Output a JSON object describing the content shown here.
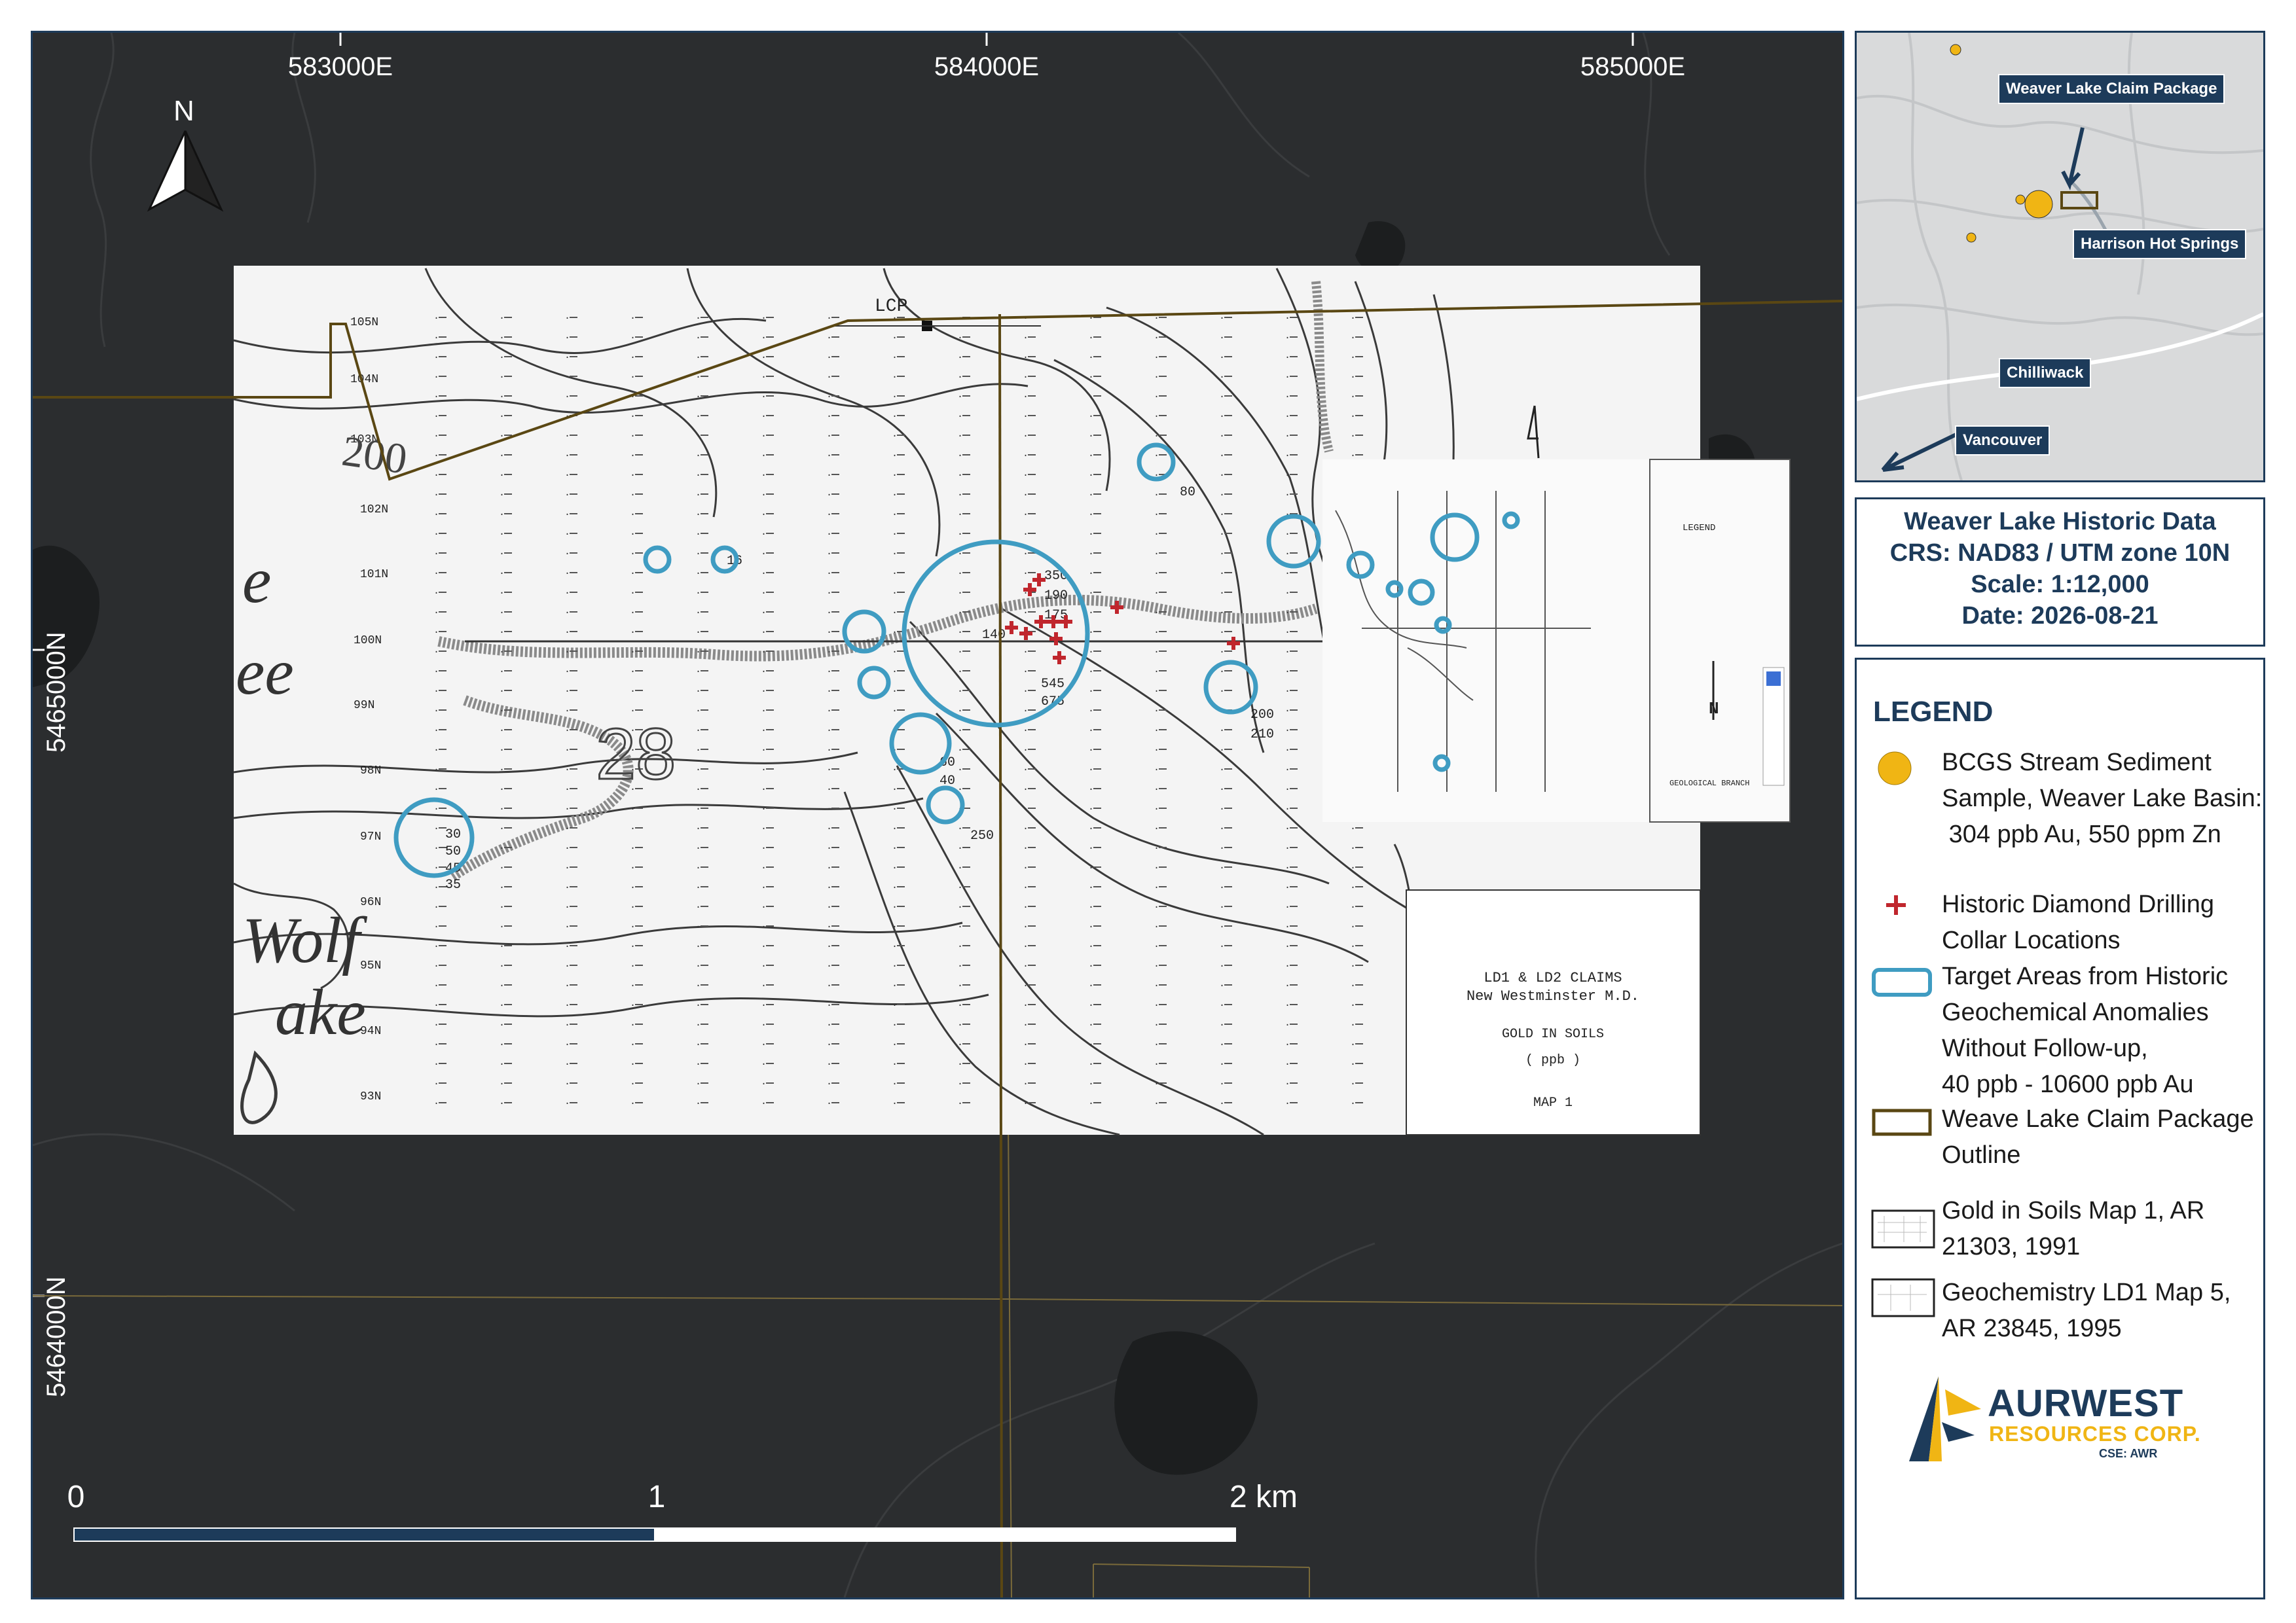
{
  "map": {
    "easting_labels": [
      "583000E",
      "584000E",
      "585000E"
    ],
    "northing_labels": [
      "5465000N",
      "5464000N"
    ],
    "north_arrow_label": "N",
    "scale_bar": {
      "labels": [
        "0",
        "1",
        "2 km"
      ]
    }
  },
  "scan_map": {
    "stamp_lines": [
      "LD1 & LD2 CLAIMS",
      "New Westminster M.D.",
      "GOLD IN SOILS",
      "( ppb )",
      "MAP 1"
    ],
    "survey_labels": [
      "LCP",
      "105N",
      "104N",
      "103N",
      "102N",
      "101N",
      "100N",
      "99N",
      "98N",
      "97N",
      "96N",
      "95N",
      "94N",
      "93N",
      "200",
      "28"
    ],
    "lake_text_upper": "e",
    "lake_text_mid": "ee",
    "wolf_lake_text": [
      "Wolf",
      "ake"
    ],
    "anomaly_values": [
      "350",
      "190",
      "175",
      "140",
      "545",
      "675",
      "200",
      "210",
      "80",
      "85",
      "60",
      "40",
      "250",
      "50",
      "45",
      "30",
      "35",
      "16"
    ],
    "inset_doc": {
      "title": "LEGEND",
      "footer": "GEOLOGICAL BRANCH",
      "north": "N"
    }
  },
  "inset_map": {
    "labels": [
      "Weaver Lake\nClaim Package",
      "Harrison Hot\nSprings",
      "Chilliwack",
      "Vancouver"
    ]
  },
  "title_block": {
    "line1": "Weaver Lake Historic Data",
    "line2": "CRS: NAD83 / UTM zone 10N",
    "line3": "Scale: 1:12,000",
    "line4": "Date: 2026-08-21"
  },
  "legend": {
    "title": "LEGEND",
    "items": [
      {
        "icon": "yellow-circle",
        "text": "BCGS Stream Sediment Sample, Weaver Lake Basin:\n 304 ppb Au, 550 ppm Zn"
      },
      {
        "icon": "red-cross",
        "text": "Historic Diamond Drilling Collar Locations"
      },
      {
        "icon": "blue-rounded-rect",
        "text": "Target Areas from Historic Geochemical Anomalies Without Follow-up,\n40 ppb - 10600 ppb Au"
      },
      {
        "icon": "brown-rect",
        "text": "Weave Lake Claim Package Outline"
      },
      {
        "icon": "scan-thumb",
        "text": "Gold in Soils Map 1, AR 21303, 1991"
      },
      {
        "icon": "scan-thumb",
        "text": "Geochemistry LD1 Map 5, AR 23845, 1995"
      }
    ]
  },
  "logo": {
    "name": "AURWEST",
    "sub": "RESOURCES CORP.",
    "ticker": "CSE: AWR"
  },
  "colors": {
    "map_bg": "#2b2d2f",
    "lake": "#1c1e1f",
    "claim_outline": "#5a4713",
    "target_circle": "#3f9cc2",
    "drill_collar": "#c0262d",
    "stream_sample": "#f0b514",
    "frame": "#1d3b5a",
    "scale_dark": "#1d3b5a"
  }
}
